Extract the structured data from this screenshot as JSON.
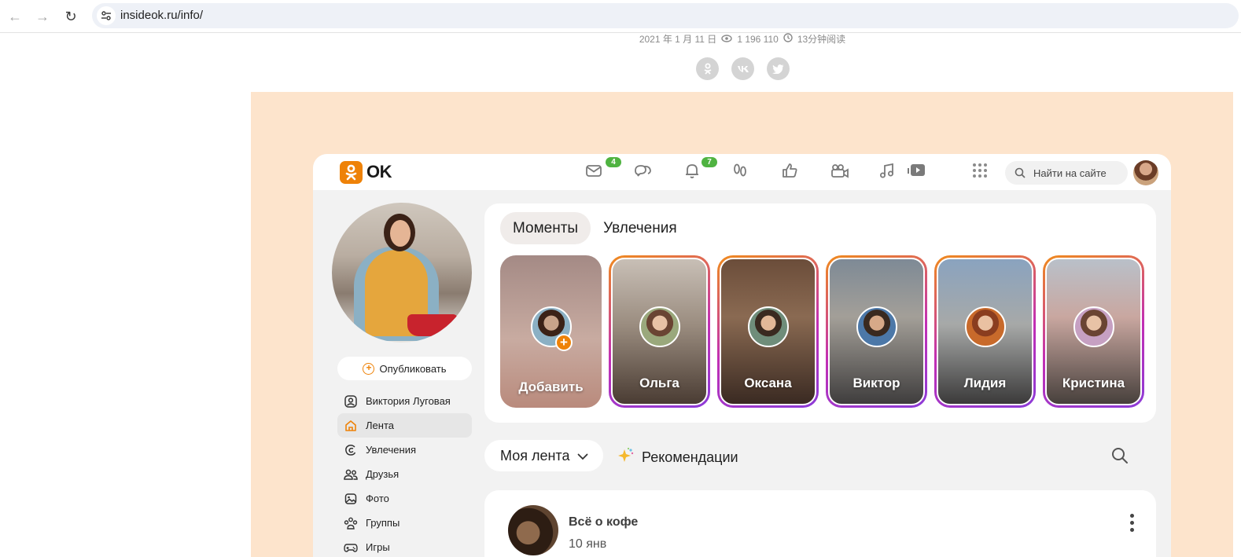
{
  "browser": {
    "url": "insideok.ru/info/"
  },
  "article": {
    "date": "2021 年 1 月 11 日",
    "views": "1 196 110",
    "read_time": "13分钟阅读"
  },
  "okapp": {
    "logo_text": "OK",
    "badges": {
      "messages": "4",
      "notifications": "7"
    },
    "search_placeholder": "Найти на сайте",
    "publish_label": "Опубликовать",
    "menu": [
      {
        "label": "Виктория Луговая",
        "icon": "user-icon"
      },
      {
        "label": "Лента",
        "icon": "home-icon"
      },
      {
        "label": "Увлечения",
        "icon": "hobby-icon"
      },
      {
        "label": "Друзья",
        "icon": "friends-icon"
      },
      {
        "label": "Фото",
        "icon": "photo-icon"
      },
      {
        "label": "Группы",
        "icon": "groups-icon"
      },
      {
        "label": "Игры",
        "icon": "games-icon"
      }
    ],
    "tabs": [
      "Моменты",
      "Увлечения"
    ],
    "stories": [
      {
        "name": "Добавить"
      },
      {
        "name": "Ольга"
      },
      {
        "name": "Оксана"
      },
      {
        "name": "Виктор"
      },
      {
        "name": "Лидия"
      },
      {
        "name": "Кристина"
      }
    ],
    "feed_select": "Моя лента",
    "recommendations": "Рекомендации",
    "post": {
      "title": "Всё о кофе",
      "date": "10 янв"
    }
  },
  "colors": {
    "ok_orange": "#ee8208",
    "badge_green": "#4fb341",
    "banner_peach": "#fde4cc"
  }
}
